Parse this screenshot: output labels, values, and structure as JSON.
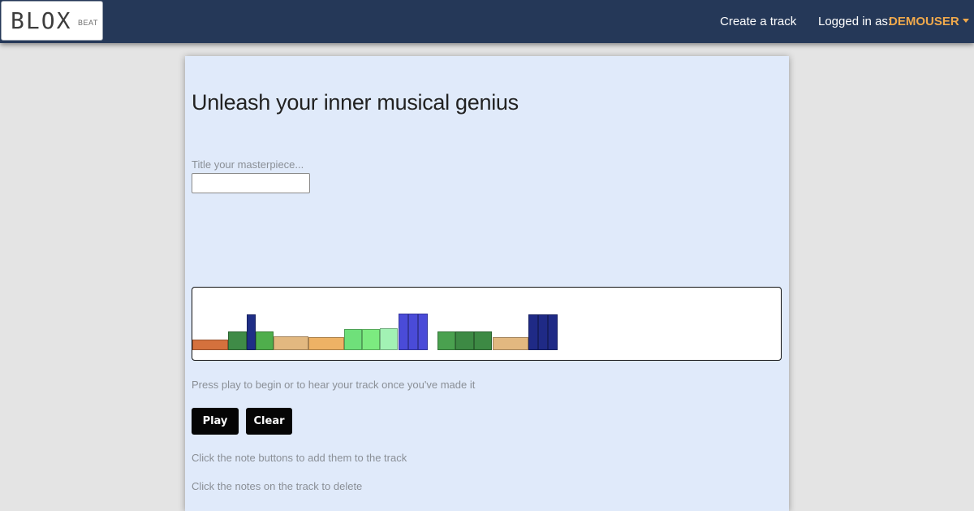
{
  "header": {
    "logo_text": "BLOX",
    "logo_subtext": "BEAT",
    "nav_create": "Create a track",
    "logged_in_label": "Logged in as:",
    "username": "DEMOUSER"
  },
  "main": {
    "heading": "Unleash your inner musical genius",
    "title_label": "Title your masterpiece...",
    "title_value": "",
    "play_hint": "Press play to begin or to hear your track once you've made it",
    "play_button": "Play",
    "clear_button": "Clear",
    "add_hint": "Click the note buttons to add them to the track",
    "delete_hint": "Click the notes on the track to delete"
  },
  "track": {
    "notes": [
      {
        "color": "#d4713d"
      },
      {
        "color": "#3f8b47"
      },
      {
        "color": "#1f2e86"
      },
      {
        "color": "#4fae4c"
      },
      {
        "color": "#e2b880"
      },
      {
        "color": "#eeb265"
      },
      {
        "color": "#6fe07a"
      },
      {
        "color": "#7ceb80"
      },
      {
        "color": "#a2f2b4"
      },
      {
        "color": "#4a4bd8"
      },
      {
        "color": "#4a4bd8"
      },
      {
        "color": "#4a4bd8"
      },
      {
        "color": "#4aa14f"
      },
      {
        "color": "#3d8a44"
      },
      {
        "color": "#3d8a44"
      },
      {
        "color": "#e2b880"
      },
      {
        "color": "#1f2a86"
      },
      {
        "color": "#1f2a86"
      },
      {
        "color": "#1f2a86"
      }
    ]
  }
}
